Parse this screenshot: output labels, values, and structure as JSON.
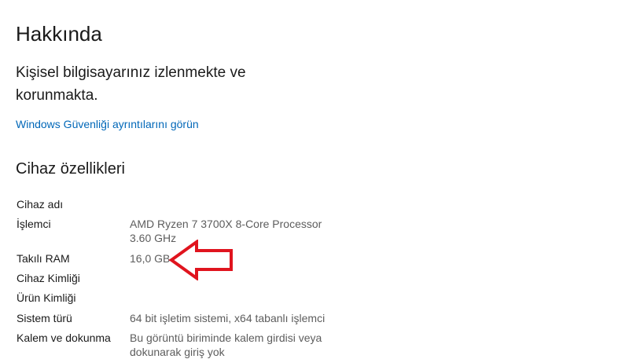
{
  "header": {
    "title": "Hakkında",
    "protection_message": "Kişisel bilgisayarınız izlenmekte ve korunmakta.",
    "security_link": "Windows Güvenliği ayrıntılarını görün"
  },
  "device_specs": {
    "title": "Cihaz özellikleri",
    "rows": [
      {
        "label": "Cihaz adı",
        "value": ""
      },
      {
        "label": "İşlemci",
        "value": "AMD Ryzen 7 3700X 8-Core Processor 3.60 GHz"
      },
      {
        "label": "Takılı RAM",
        "value": "16,0 GB"
      },
      {
        "label": "Cihaz Kimliği",
        "value": ""
      },
      {
        "label": "Ürün Kimliği",
        "value": ""
      },
      {
        "label": "Sistem türü",
        "value": "64 bit işletim sistemi, x64 tabanlı işlemci"
      },
      {
        "label": "Kalem ve dokunma",
        "value": "Bu görüntü biriminde kalem girdisi veya dokunarak giriş yok"
      }
    ]
  },
  "colors": {
    "link": "#0067b8",
    "annotation_arrow": "#e0141e"
  },
  "annotation": {
    "icon": "left-arrow-icon"
  }
}
